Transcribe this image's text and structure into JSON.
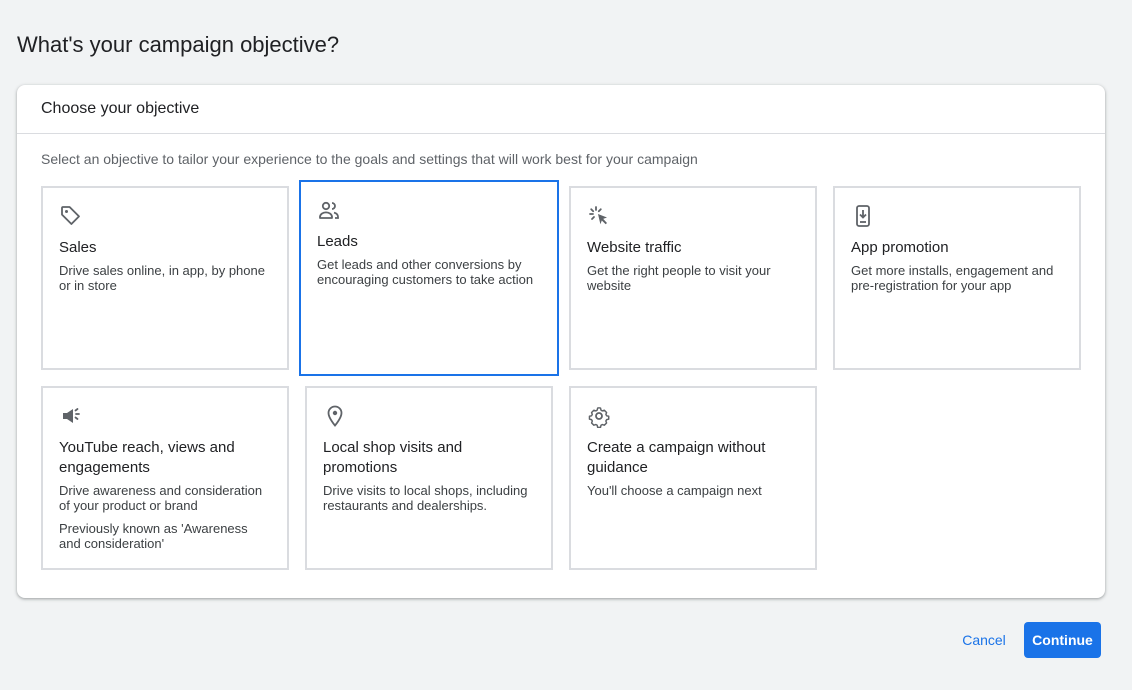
{
  "page": {
    "title": "What's your campaign objective?"
  },
  "panel": {
    "header": "Choose your objective",
    "subtitle": "Select an objective to tailor your experience to the goals and settings that will work best for your campaign"
  },
  "objectives": [
    {
      "title": "Sales",
      "desc": "Drive sales online, in app, by phone or in store",
      "icon": "tag-icon"
    },
    {
      "title": "Leads",
      "desc": "Get leads and other conversions by encouraging customers to take action",
      "icon": "people-icon",
      "selected": true
    },
    {
      "title": "Website traffic",
      "desc": "Get the right people to visit your website",
      "icon": "cursor-click-icon"
    },
    {
      "title": "App promotion",
      "desc": "Get more installs, engagement and pre-registration for your app",
      "icon": "phone-download-icon"
    },
    {
      "title": "YouTube reach, views and engagements",
      "desc": "Drive awareness and consideration of your product or brand",
      "note": "Previously known as 'Awareness and consideration'",
      "icon": "megaphone-icon"
    },
    {
      "title": "Local shop visits and promotions",
      "desc": "Drive visits to local shops, including restaurants and dealerships.",
      "icon": "location-pin-icon"
    },
    {
      "title": "Create a campaign without guidance",
      "desc": "You'll choose a campaign next",
      "icon": "gear-icon"
    }
  ],
  "actions": {
    "cancel_label": "Cancel",
    "continue_label": "Continue"
  },
  "colors": {
    "accent": "#1a73e8",
    "background": "#f1f3f4",
    "card_border": "#dadce0"
  }
}
